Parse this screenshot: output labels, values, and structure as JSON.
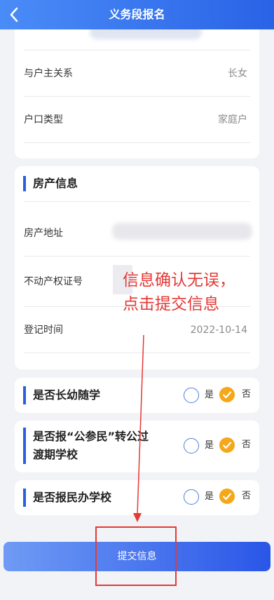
{
  "header": {
    "title": "义务段报名"
  },
  "card1": {
    "rows": [
      {
        "label": "与户主关系",
        "value": "长女"
      },
      {
        "label": "户口类型",
        "value": "家庭户"
      }
    ]
  },
  "property": {
    "title": "房产信息",
    "rows": [
      {
        "label": "房产地址",
        "value": ""
      },
      {
        "label": "不动产权证号",
        "value": ""
      },
      {
        "label": "登记时间",
        "value": "2022-10-14"
      }
    ]
  },
  "questions": [
    {
      "title": "是否长幼随学",
      "yes": "是",
      "no": "否",
      "selected": "否"
    },
    {
      "title_line1": "是否报“公参民”转公过",
      "title_line2": "渡期学校",
      "yes": "是",
      "no": "否",
      "selected": "否"
    },
    {
      "title": "是否报民办学校",
      "yes": "是",
      "no": "否",
      "selected": "否"
    }
  ],
  "submit": {
    "label": "提交信息"
  },
  "annotation": {
    "line1": "信息确认无误，",
    "line2": "点击提交信息"
  },
  "colors": {
    "accent": "#2a5fe0",
    "checked": "#f5a71a",
    "annotation": "#e53935"
  }
}
